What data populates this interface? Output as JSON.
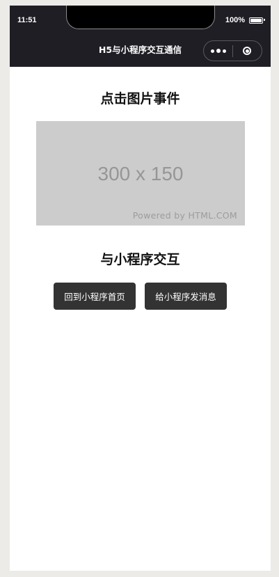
{
  "status_bar": {
    "time": "11:51",
    "battery": "100%"
  },
  "nav": {
    "title": "H5与小程序交互通信",
    "more_icon": "more-dots-icon",
    "close_icon": "target-circle-icon"
  },
  "section1": {
    "title": "点击图片事件",
    "placeholder_size": "300 x 150",
    "placeholder_powered": "Powered by HTML.COM"
  },
  "section2": {
    "title": "与小程序交互",
    "buttons": [
      {
        "label": "回到小程序首页"
      },
      {
        "label": "给小程序发消息"
      }
    ]
  },
  "colors": {
    "header_bg": "#1f1e24",
    "button_bg": "#333333",
    "placeholder_bg": "#cccccc",
    "page_bg": "#ecebe7"
  }
}
